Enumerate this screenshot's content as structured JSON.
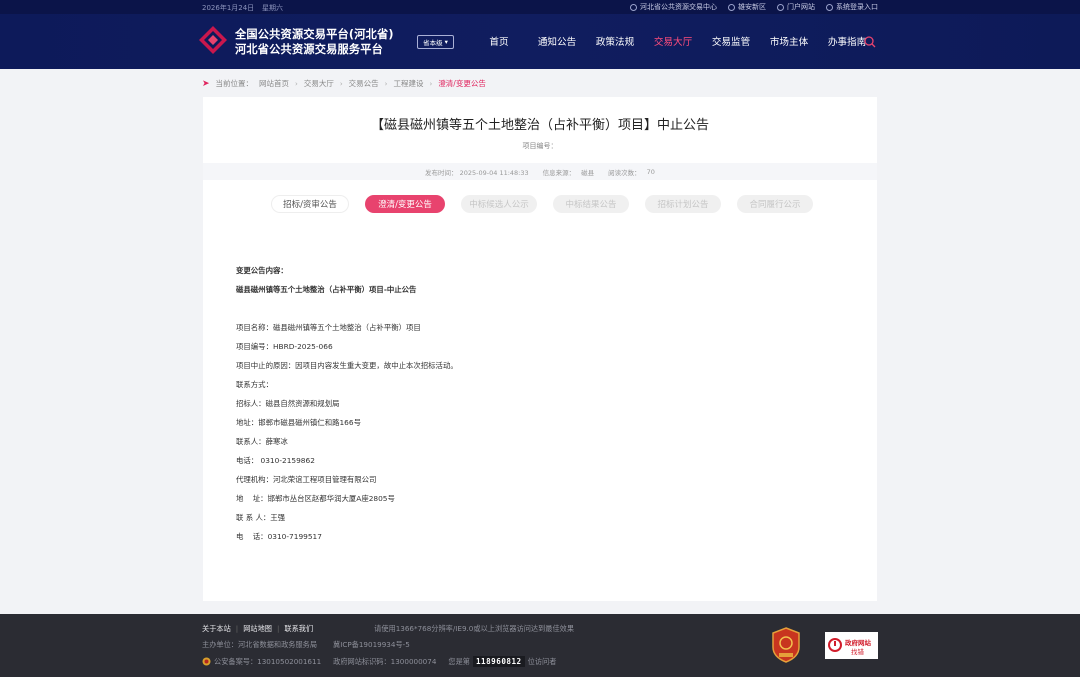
{
  "topbar": {
    "date": "2026年1月24日",
    "weekday": "星期六",
    "links": [
      "河北省公共资源交易中心",
      "雄安新区",
      "门户网站",
      "系统登录入口"
    ]
  },
  "header": {
    "brand_line1": "全国公共资源交易平台(河北省)",
    "brand_line2": "河北省公共资源交易服务平台",
    "level_select": "省本级",
    "nav": [
      "首页",
      "通知公告",
      "政策法规",
      "交易大厅",
      "交易监管",
      "市场主体",
      "办事指南"
    ],
    "active_nav": "交易大厅"
  },
  "breadcrumb": {
    "label": "当前位置：",
    "items": [
      "网站首页",
      "交易大厅",
      "交易公告",
      "工程建设"
    ],
    "current": "澄清/变更公告"
  },
  "article": {
    "title": "【磁县磁州镇等五个土地整治（占补平衡）项目】中止公告",
    "project_no_label": "项目编号：",
    "publish_time": "发布时间：  2025-09-04 11:48:33",
    "source_label": "信息来源：",
    "source": "磁县",
    "views_label": "阅读次数：",
    "views": "70"
  },
  "tabs": [
    {
      "label": "招标/资审公告",
      "state": "normal"
    },
    {
      "label": "澄清/变更公告",
      "state": "active"
    },
    {
      "label": "中标候选人公示",
      "state": "disabled"
    },
    {
      "label": "中标结果公告",
      "state": "disabled"
    },
    {
      "label": "招标计划公告",
      "state": "disabled"
    },
    {
      "label": "合同履行公示",
      "state": "disabled"
    }
  ],
  "content": {
    "heading": "变更公告内容：",
    "subheading": "磁县磁州镇等五个土地整治（占补平衡）项目-中止公告",
    "lines": [
      "项目名称：磁县磁州镇等五个土地整治（占补平衡）项目",
      "项目编号：HBRD-2025-066",
      "项目中止的原因：因项目内容发生重大变更，故中止本次招标活动。",
      "联系方式：",
      "招标人：磁县自然资源和规划局",
      "地址：邯郸市磁县磁州镇仁和路166号",
      "联系人：薛寒冰",
      "电话： 0310-2159862",
      "代理机构：河北荣谊工程项目管理有限公司",
      "地    址：邯郸市丛台区赵都华润大厦A座2805号",
      "联 系 人：王强",
      "电    话：0310-7199517"
    ]
  },
  "footer": {
    "links": [
      "关于本站",
      "网站地图",
      "联系我们"
    ],
    "browser_hint": "请使用1366*768分辨率/IE9.0或以上浏览器访问达到最佳效果",
    "sponsor": "主办单位：河北省数据和政务服务局",
    "icp": "冀ICP备19019934号-5",
    "police": "公安备案号：13010502001611",
    "gov_id": "政府网站标识码：1300000074",
    "visit_prefix": "您是第",
    "visit_count": "118960812",
    "visit_suffix": "位访问者",
    "badge2_line1": "政府网站",
    "badge2_line2": "找错"
  }
}
